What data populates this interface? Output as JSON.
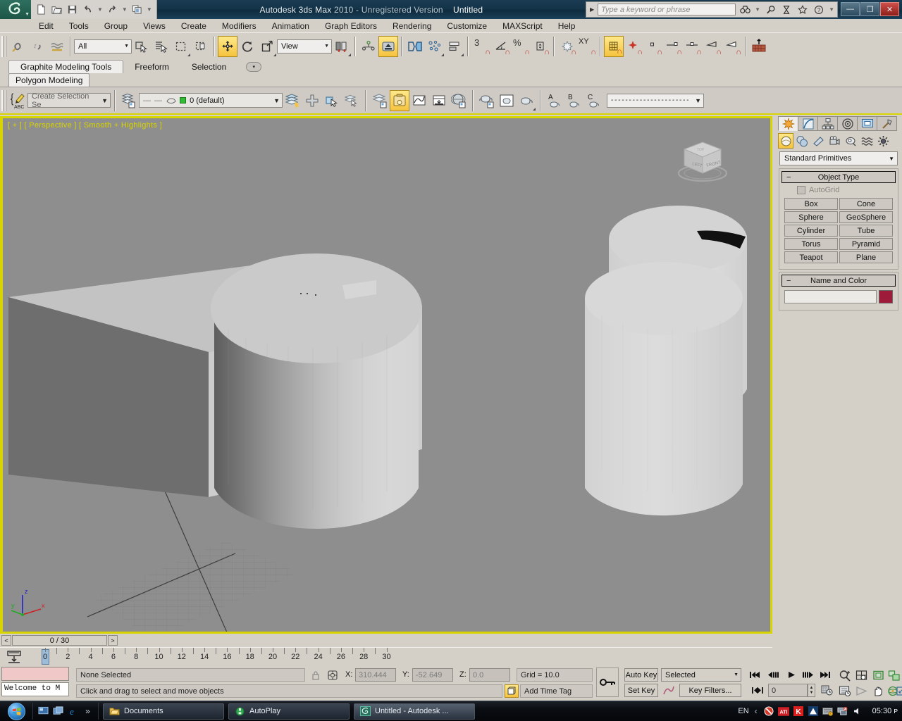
{
  "window": {
    "app_name": "Autodesk 3ds Max",
    "version": "2010",
    "license": "- Unregistered Version",
    "document": "Untitled",
    "minimize_label": "—",
    "maximize_label": "❐",
    "close_label": "✕"
  },
  "quick_access": {
    "items": [
      {
        "name": "new-file-icon",
        "glyph": "🗋"
      },
      {
        "name": "open-file-icon",
        "glyph": "🗁"
      },
      {
        "name": "save-file-icon",
        "glyph": "💾"
      },
      {
        "name": "undo-icon",
        "glyph": "↩"
      },
      {
        "name": "redo-icon",
        "glyph": "↪"
      },
      {
        "name": "project-folder-icon",
        "glyph": "🗐"
      }
    ],
    "dropdown_glyph": "▼"
  },
  "search": {
    "placeholder": "Type a keyword or phrase",
    "expand_glyph": "▶",
    "icons": [
      {
        "name": "binoculars-icon",
        "glyph": "👓"
      },
      {
        "name": "search-magnifier-icon",
        "glyph": "🔍"
      },
      {
        "name": "subscription-icon",
        "glyph": "⌛"
      },
      {
        "name": "favorites-star-icon",
        "glyph": "☆"
      },
      {
        "name": "help-question-icon",
        "glyph": "?"
      }
    ]
  },
  "menu": {
    "items": [
      "Edit",
      "Tools",
      "Group",
      "Views",
      "Create",
      "Modifiers",
      "Animation",
      "Graph Editors",
      "Rendering",
      "Customize",
      "MAXScript",
      "Help"
    ]
  },
  "main_toolbar": {
    "selection_filter": "All",
    "reference_coord_system": "View",
    "link_tools": [
      {
        "name": "select-and-link-icon",
        "glyph": "⛓"
      },
      {
        "name": "unlink-selection-icon",
        "glyph": "⛓"
      },
      {
        "name": "bind-to-space-warp-icon",
        "glyph": "〰"
      }
    ],
    "select_tools": [
      {
        "name": "select-object-icon",
        "glyph": "⬚"
      },
      {
        "name": "select-by-name-icon",
        "glyph": "☰"
      },
      {
        "name": "rectangular-selection-region-icon",
        "glyph": "▭"
      },
      {
        "name": "window-crossing-icon",
        "glyph": "◳"
      }
    ],
    "transform_tools": [
      {
        "name": "select-and-move-icon",
        "glyph": "✥",
        "active": true
      },
      {
        "name": "select-and-rotate-icon",
        "glyph": "↻",
        "active": false
      },
      {
        "name": "select-and-scale-icon",
        "glyph": "⬈",
        "active": false
      }
    ],
    "pivot_tools": [
      {
        "name": "use-pivot-point-center-icon",
        "glyph": "⊹"
      },
      {
        "name": "select-and-manipulate-icon",
        "glyph": "⬆",
        "active": true
      },
      {
        "name": "mirror-icon",
        "glyph": "⊨"
      },
      {
        "name": "align-icon",
        "glyph": "⊞"
      },
      {
        "name": "layer-manager-icon",
        "glyph": "▤"
      }
    ],
    "snap_tools": [
      {
        "name": "snaps-toggle-3-icon",
        "glyph": "3"
      },
      {
        "name": "angle-snap-toggle-icon",
        "glyph": "∠"
      },
      {
        "name": "percent-snap-toggle-icon",
        "glyph": "%"
      },
      {
        "name": "spinner-snap-toggle-icon",
        "glyph": "⇅"
      },
      {
        "name": "edit-named-selection-sets-icon",
        "glyph": "✳"
      },
      {
        "name": "xy-constraint-icon",
        "glyph": "XY"
      },
      {
        "name": "curve-editor-icon",
        "glyph": "▦",
        "active": true
      },
      {
        "name": "schematic-view-icon",
        "glyph": "✦"
      },
      {
        "name": "material-editor-small-icon",
        "glyph": "▫"
      },
      {
        "name": "render-setup-icon",
        "glyph": "—▫"
      },
      {
        "name": "rendered-frame-window-icon",
        "glyph": "-▫-"
      },
      {
        "name": "render-production-icon",
        "glyph": "◁"
      },
      {
        "name": "render-iterative-icon",
        "glyph": "◁"
      },
      {
        "name": "activeshade-icon",
        "glyph": "▦↑"
      }
    ]
  },
  "ribbon": {
    "tabs": [
      {
        "label": "Graphite Modeling Tools",
        "active": true
      },
      {
        "label": "Freeform",
        "active": false
      },
      {
        "label": "Selection",
        "active": false
      }
    ],
    "more_glyph": "▾",
    "subtab": "Polygon Modeling",
    "selection_set_placeholder": "Create Selection Se",
    "layer_value": "0 (default)",
    "layer_color": "#33bb33",
    "dash_prefix": "— —",
    "dotted_dropdown": "- - - - - - - - - - - - - - - - - - - - - -",
    "panel_left_icons": [
      {
        "name": "named-selection-sets-icon",
        "glyph": "✎"
      }
    ],
    "panel_mid_icons": [
      {
        "name": "layer-explorer-icon",
        "glyph": "▤"
      },
      {
        "name": "create-layer-icon",
        "glyph": "✛"
      },
      {
        "name": "select-object-layer-icon",
        "glyph": "▢"
      },
      {
        "name": "add-to-layer-icon",
        "glyph": "▥"
      },
      {
        "name": "scene-explorer-icon",
        "glyph": "▤"
      },
      {
        "name": "manage-scene-states-icon",
        "glyph": "📋",
        "active": true
      },
      {
        "name": "curve-editor-panel-icon",
        "glyph": "📈"
      },
      {
        "name": "dope-sheet-icon",
        "glyph": "⊼"
      },
      {
        "name": "material-editor-icon",
        "glyph": "◍"
      },
      {
        "name": "teapot-a-icon",
        "glyph": "🫖"
      },
      {
        "name": "teapot-b-icon",
        "glyph": "🫖"
      },
      {
        "name": "teapot-c-icon",
        "glyph": "🫖"
      },
      {
        "name": "preview-a-icon",
        "glyph": "A"
      },
      {
        "name": "preview-b-icon",
        "glyph": "B"
      },
      {
        "name": "preview-c-icon",
        "glyph": "C"
      }
    ]
  },
  "viewport": {
    "label": "[ + ] [ Perspective ] [ Smooth + Highlights ]",
    "background_color": "#8e8e8e",
    "border_color": "#d8d400",
    "viewcube_faces": {
      "left": "LEFT",
      "front": "FRONT",
      "top": "TOP"
    },
    "axis_labels": {
      "x": "x",
      "y": "y",
      "z": "z"
    },
    "axis_colors": {
      "x": "#cc2222",
      "y": "#22aa22",
      "z": "#2222cc"
    }
  },
  "timeline": {
    "prev_glyph": "<",
    "next_glyph": ">",
    "current_frame_display": "0 / 30",
    "ruler_labels": [
      "2",
      "4",
      "6",
      "8",
      "10",
      "12",
      "14",
      "16",
      "18",
      "20",
      "22",
      "24",
      "26",
      "28",
      "30"
    ],
    "slider_position_frame": 0
  },
  "status": {
    "maxscript_listener_placeholder": "",
    "welcome_text": "Welcome to M",
    "selection_text": "None Selected",
    "prompt_text": "Click and drag to select and move objects",
    "lock_icon": "🔒",
    "absolute_mode_icon": "⊕",
    "coords": {
      "x_label": "X:",
      "x_value": "310.444",
      "y_label": "Y:",
      "y_value": "-52.649",
      "z_label": "Z:",
      "z_value": "0.0"
    },
    "grid_text": "Grid = 10.0",
    "add_time_tag": "Add Time Tag",
    "time_tag_icon_name": "time-tag-icon",
    "key_mode_icon": "⚷"
  },
  "animation": {
    "auto_key": "Auto Key",
    "set_key": "Set Key",
    "selection_level": "Selected",
    "key_filters": "Key Filters...",
    "frame_field_value": "0",
    "playback": [
      {
        "name": "go-to-start-button",
        "glyph": "|◀◀"
      },
      {
        "name": "previous-frame-button",
        "glyph": "◀|||"
      },
      {
        "name": "play-animation-button",
        "glyph": "▶"
      },
      {
        "name": "next-frame-button",
        "glyph": "|||▶"
      },
      {
        "name": "go-to-end-button",
        "glyph": "▶▶|"
      }
    ],
    "key_mode_toggle": "|◀▶|",
    "time_configuration_name": "time-configuration-button"
  },
  "nav_controls": [
    {
      "name": "zoom-button",
      "glyph": "🔍"
    },
    {
      "name": "zoom-all-button",
      "glyph": "⊞"
    },
    {
      "name": "zoom-extents-button",
      "glyph": "▣"
    },
    {
      "name": "zoom-extents-all-button",
      "glyph": "▤"
    },
    {
      "name": "field-of-view-button",
      "glyph": "▧"
    },
    {
      "name": "pan-view-button",
      "glyph": "✋"
    },
    {
      "name": "orbit-button",
      "glyph": "⟳"
    },
    {
      "name": "maximize-viewport-toggle-button",
      "glyph": "⤢"
    }
  ],
  "command_panel": {
    "tabs": [
      {
        "name": "create-tab",
        "glyph": "✳",
        "active": true
      },
      {
        "name": "modify-tab",
        "glyph": "◪",
        "active": false
      },
      {
        "name": "hierarchy-tab",
        "glyph": "⛁",
        "active": false
      },
      {
        "name": "motion-tab",
        "glyph": "◎",
        "active": false
      },
      {
        "name": "display-tab",
        "glyph": "▣",
        "active": false
      },
      {
        "name": "utilities-tab",
        "glyph": "🔨",
        "active": false
      }
    ],
    "category_buttons": [
      {
        "name": "geometry-category",
        "glyph": "◯",
        "active": true
      },
      {
        "name": "shapes-category",
        "glyph": "◑",
        "active": false
      },
      {
        "name": "lights-category",
        "glyph": "◣",
        "active": false
      },
      {
        "name": "cameras-category",
        "glyph": "🎥",
        "active": false
      },
      {
        "name": "helpers-category",
        "glyph": "◔",
        "active": false
      },
      {
        "name": "space-warps-category",
        "glyph": "≈",
        "active": false
      },
      {
        "name": "systems-category",
        "glyph": "⚙",
        "active": false
      }
    ],
    "subcategory": "Standard Primitives",
    "object_type": {
      "title": "Object Type",
      "collapse_glyph": "−",
      "autogrid_label": "AutoGrid",
      "buttons": [
        "Box",
        "Cone",
        "Sphere",
        "GeoSphere",
        "Cylinder",
        "Tube",
        "Torus",
        "Pyramid",
        "Teapot",
        "Plane"
      ]
    },
    "name_and_color": {
      "title": "Name and Color",
      "collapse_glyph": "−",
      "name_value": "",
      "color": "#9e1b3a"
    }
  },
  "taskbar": {
    "start_name": "start-button",
    "quick_launch": [
      {
        "name": "show-desktop-icon",
        "glyph": "🖥"
      },
      {
        "name": "switch-window-icon",
        "glyph": "🗗"
      },
      {
        "name": "internet-explorer-icon",
        "glyph": "e"
      },
      {
        "name": "quick-launch-overflow-icon",
        "glyph": "»"
      }
    ],
    "tasks": [
      {
        "name": "taskbar-item-documents",
        "label": "Documents",
        "icon": "folder-icon",
        "active": false
      },
      {
        "name": "taskbar-item-autoplay",
        "label": "AutoPlay",
        "icon": "autoplay-icon",
        "active": false
      },
      {
        "name": "taskbar-item-3dsmax",
        "label": "Untitled - Autodesk ...",
        "icon": "max-icon",
        "active": true
      }
    ],
    "tray": {
      "language": "EN",
      "expand_glyph": "‹",
      "icons": [
        {
          "name": "antivirus-tray-icon",
          "glyph": "⊘"
        },
        {
          "name": "ati-catalyst-tray-icon",
          "glyph": "ATI"
        },
        {
          "name": "kaspersky-tray-icon",
          "glyph": "K"
        },
        {
          "name": "autodesk-tray-icon",
          "glyph": "A"
        },
        {
          "name": "keyboard-tray-icon",
          "glyph": "⌨"
        },
        {
          "name": "network-tray-icon",
          "glyph": "🖧"
        },
        {
          "name": "volume-tray-icon",
          "glyph": "🔊"
        }
      ],
      "clock": "05:30 ᴘ"
    }
  }
}
